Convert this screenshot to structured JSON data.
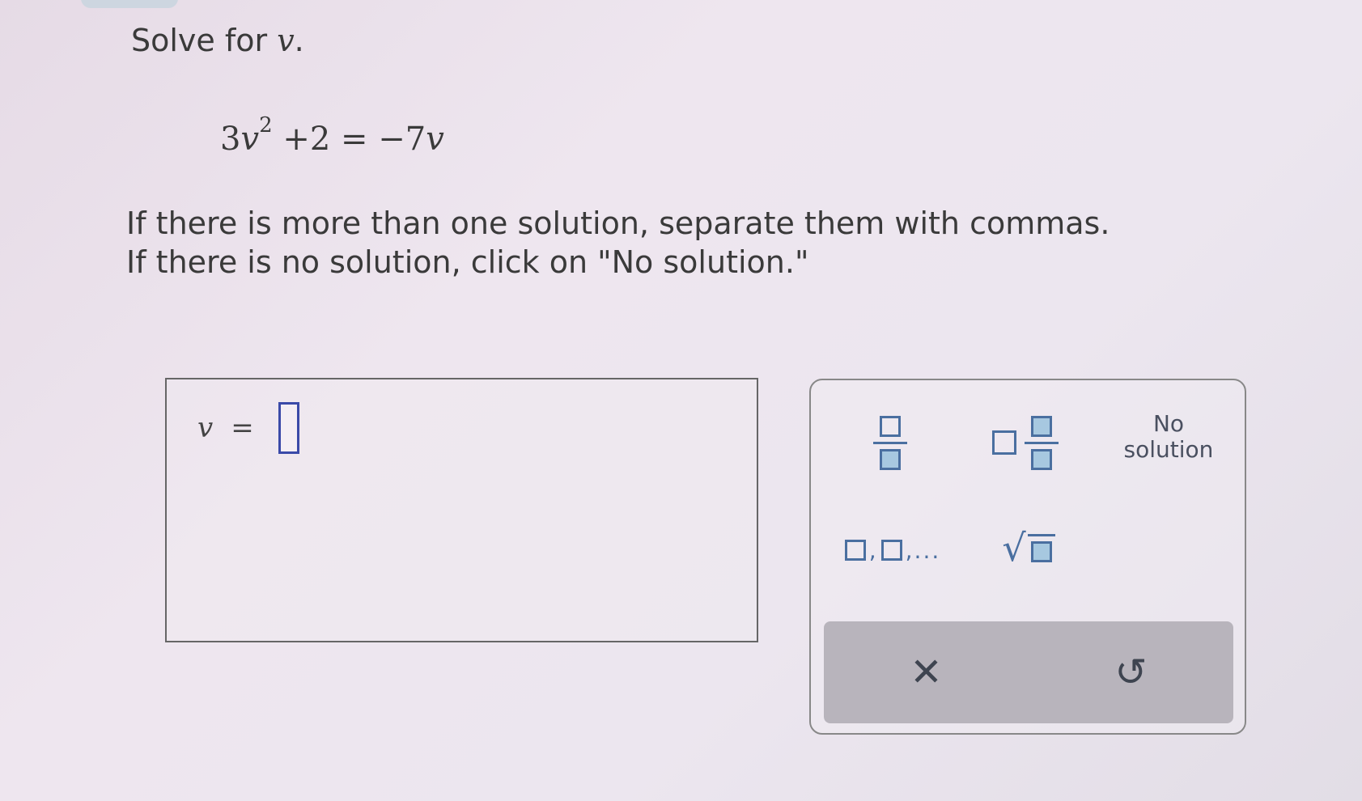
{
  "instruction": {
    "prefix": "Solve for ",
    "variable": "v",
    "suffix": "."
  },
  "equation": {
    "coef": "3",
    "var1": "v",
    "exponent": "2",
    "rest": " +2 = −7",
    "var2": "v"
  },
  "note": {
    "line1": "If there is more than one solution, separate them with commas.",
    "line2": "If there is no solution, click on \"No solution.\""
  },
  "answer": {
    "variable": "v",
    "equals": "=",
    "value": ""
  },
  "keypad": {
    "no_solution_line1": "No",
    "no_solution_line2": "solution",
    "list_separator": ",",
    "list_ellipsis": ",...",
    "sqrt_symbol": "√",
    "clear_symbol": "✕",
    "undo_symbol": "↺"
  }
}
